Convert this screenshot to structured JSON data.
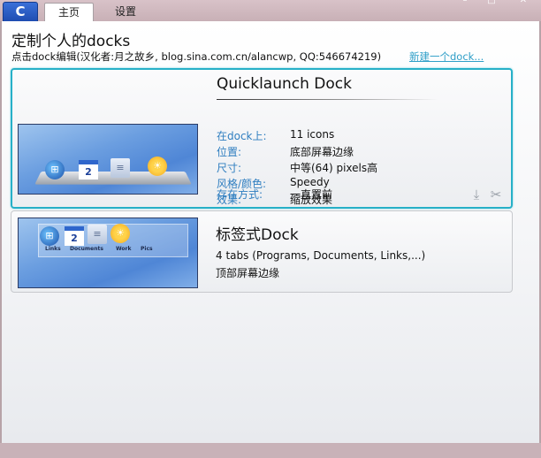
{
  "titlebar": {
    "logo_text": "C",
    "tabs": [
      {
        "label": "主页",
        "active": true
      },
      {
        "label": "设置",
        "active": false
      }
    ]
  },
  "header": {
    "title": "定制个人的docks",
    "subtitle": "点击dock编辑(汉化者:月之故乡, blog.sina.com.cn/alancwp, QQ:546674219)",
    "new_dock_link": "新建一个dock..."
  },
  "docks": [
    {
      "name": "Quicklaunch Dock",
      "selected": true,
      "properties": [
        {
          "label": "在dock上:",
          "value": "11 icons"
        },
        {
          "label": "位置:",
          "value": "底部屏幕边缘"
        },
        {
          "label": "尺寸:",
          "value": "中等(64) pixels高"
        },
        {
          "label": "风格/颜色:",
          "value": "Speedy"
        },
        {
          "label": "效果:",
          "value": "缩放效果"
        },
        {
          "label": "存在方式:",
          "value": "一直置前"
        }
      ],
      "preview": {
        "icons": [
          {
            "name": "windows-logo-icon",
            "glyph": "⊞"
          },
          {
            "name": "calendar-icon",
            "glyph": "2"
          },
          {
            "name": "document-icon",
            "glyph": "≡"
          },
          {
            "name": "weather-sun-icon",
            "glyph": "☀"
          }
        ]
      },
      "actions": [
        {
          "name": "download-icon",
          "glyph": "⤓"
        },
        {
          "name": "delete-tools-icon",
          "glyph": "✂"
        }
      ]
    },
    {
      "name": "标签式Dock",
      "selected": false,
      "line1": "4 tabs (Programs, Documents, Links,...)",
      "line2": "顶部屏幕边缘",
      "preview": {
        "icons": [
          {
            "name": "windows-logo-icon",
            "glyph": "⊞"
          },
          {
            "name": "calendar-icon",
            "glyph": "2"
          },
          {
            "name": "document-icon",
            "glyph": "≡"
          },
          {
            "name": "weather-sun-icon",
            "glyph": "☀"
          }
        ],
        "tab_labels": [
          "Links",
          "Documents",
          "Work",
          "Pics"
        ]
      }
    }
  ],
  "colors": {
    "accent": "#27b0c8",
    "label_blue": "#2f7ec0",
    "link": "#2f9fc8",
    "frame": "#c8b0b6"
  }
}
